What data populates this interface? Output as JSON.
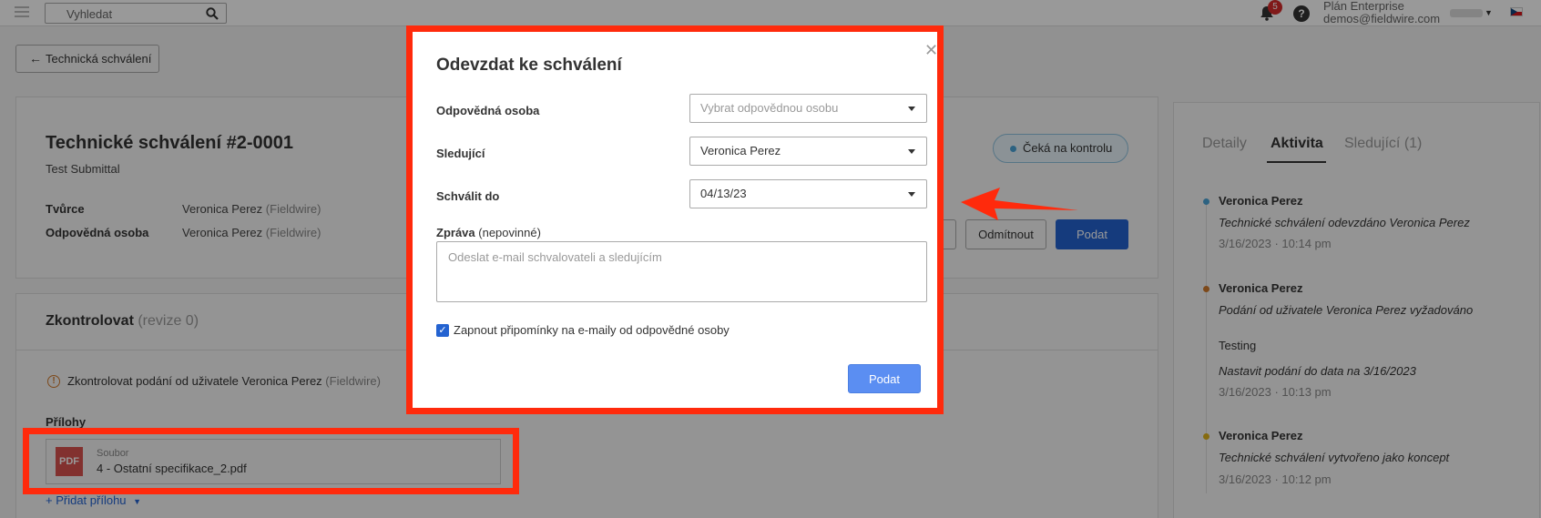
{
  "topbar": {
    "search_placeholder": "Vyhledat",
    "notifications_count": "5",
    "help_label": "?",
    "plan": "Plán Enterprise",
    "email": "demos@fieldwire.com"
  },
  "back_button": {
    "label": "Technická schválení"
  },
  "submittal": {
    "title": "Technické schválení #2-0001",
    "subtitle": "Test Submittal",
    "creator_label": "Tvůrce",
    "creator_name": "Veronica Perez",
    "creator_org": "(Fieldwire)",
    "responsible_label": "Odpovědná osoba",
    "responsible_name": "Veronica Perez",
    "responsible_org": "(Fieldwire)",
    "status": "Čeká na kontrolu",
    "reject_label": "Odmítnout",
    "submit_label": "Podat"
  },
  "review": {
    "title": "Zkontrolovat",
    "revision": "(revize 0)",
    "warning_text": "Zkontrolovat podání od uživatele Veronica Perez",
    "warning_org": "(Fieldwire)",
    "attachments_label": "Přílohy",
    "attachment_kind": "Soubor",
    "attachment_name": "4 - Ostatní specifikace_2.pdf",
    "pdf_badge": "PDF",
    "add_attachment": "+ Přidat přílohu"
  },
  "sidebar": {
    "tabs": [
      {
        "label": "Detaily"
      },
      {
        "label": "Aktivita"
      },
      {
        "label": "Sledující (1)"
      }
    ],
    "activity": [
      {
        "name": "Veronica Perez",
        "desc": "Technické schválení odevzdáno Veronica Perez",
        "date": "3/16/2023 · 10:14 pm",
        "color": "#4aa3d8"
      },
      {
        "name": "Veronica Perez",
        "desc": "Podání od uživatele Veronica Perez vyžadováno",
        "note": "Testing",
        "desc2": "Nastavit podání do data na 3/16/2023",
        "date": "3/16/2023 · 10:13 pm",
        "color": "#d07a2c"
      },
      {
        "name": "Veronica Perez",
        "desc": "Technické schválení vytvořeno jako koncept",
        "date": "3/16/2023 · 10:12 pm",
        "color": "#e0b21a"
      }
    ]
  },
  "modal": {
    "title": "Odevzdat ke schválení",
    "responsible_label": "Odpovědná osoba",
    "responsible_placeholder": "Vybrat odpovědnou osobu",
    "followers_label": "Sledující",
    "followers_value": "Veronica Perez",
    "approve_by_label": "Schválit do",
    "approve_by_value": "04/13/23",
    "message_label": "Zpráva",
    "message_optional": "(nepovinné)",
    "message_placeholder": "Odeslat e-mail schvalovateli a sledujícím",
    "reminder_label": "Zapnout připomínky na e-maily od odpovědné osoby",
    "reminder_checked": true,
    "submit_label": "Podat"
  },
  "colors": {
    "primary": "#2463d1",
    "highlight": "#ff2a0c",
    "status": "#4aa3d8"
  }
}
